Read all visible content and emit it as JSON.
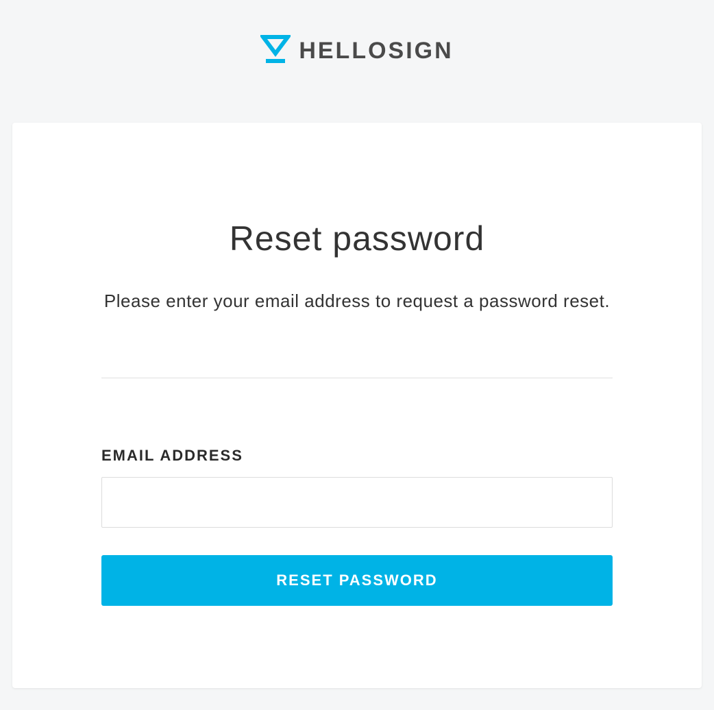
{
  "brand": {
    "name": "HELLOSIGN",
    "accent_color": "#00b3e6"
  },
  "card": {
    "title": "Reset password",
    "subtitle": "Please enter your email address to request a password reset."
  },
  "form": {
    "email_label": "EMAIL ADDRESS",
    "email_value": "",
    "email_placeholder": "",
    "submit_label": "RESET PASSWORD"
  }
}
